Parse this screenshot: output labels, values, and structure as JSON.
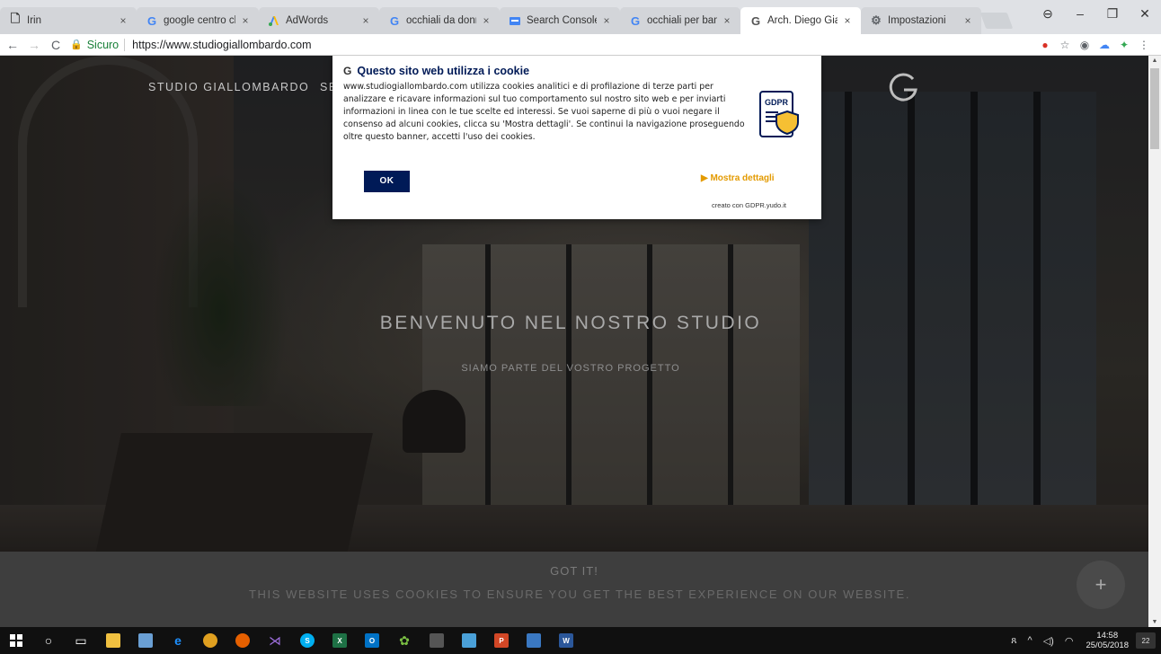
{
  "tabs": [
    {
      "label": "Irin",
      "favicon": "page-icon",
      "left": 0
    },
    {
      "label": "google centro clie",
      "favicon": "google-icon"
    },
    {
      "label": "AdWords",
      "favicon": "adwords-icon"
    },
    {
      "label": "occhiali da donna",
      "favicon": "google-icon"
    },
    {
      "label": "Search Console - H",
      "favicon": "search-console-icon"
    },
    {
      "label": "occhiali per bambi",
      "favicon": "google-icon"
    },
    {
      "label": "Arch. Diego Giallor",
      "favicon": "g-logo-icon",
      "active": true
    },
    {
      "label": "Impostazioni",
      "favicon": "gear-icon"
    }
  ],
  "omnibox": {
    "secure_label": "Sicuro",
    "url": "https://www.studiogiallombardo.com"
  },
  "site": {
    "brand": "STUDIO GIALLOMBARDO",
    "nav_partial": "SE",
    "hero_title": "BENVENUTO NEL NOSTRO STUDIO",
    "hero_subtitle": "SIAMO PARTE DEL VOSTRO PROGETTO"
  },
  "gdpr": {
    "title": "Questo sito web utilizza i cookie",
    "body": "www.studiogiallombardo.com utilizza cookies analitici e di profilazione di terze parti per analizzare e ricavare informazioni sul tuo comportamento sul nostro sito web e per inviarti informazioni in linea con le tue scelte ed interessi. Se vuoi saperne di più o vuoi negare il consenso ad alcuni cookies, clicca su 'Mostra dettagli'. Se continui la navigazione proseguendo oltre questo banner, accetti l'uso dei cookies.",
    "badge_label": "GDPR",
    "ok_label": "OK",
    "more_label": "▶ Mostra dettagli",
    "credit": "creato con GDPR.yudo.it"
  },
  "cookiebar": {
    "gotit": "GOT IT!",
    "message": "THIS WEBSITE USES COOKIES TO ENSURE YOU GET THE BEST EXPERIENCE ON OUR WEBSITE."
  },
  "fab_label": "+",
  "taskbar": {
    "time": "14:58",
    "date": "25/05/2018",
    "notifications": "22"
  },
  "colors": {
    "gdpr_navy": "#001a57",
    "gdpr_orange": "#e39a00",
    "secure_green": "#188038"
  }
}
